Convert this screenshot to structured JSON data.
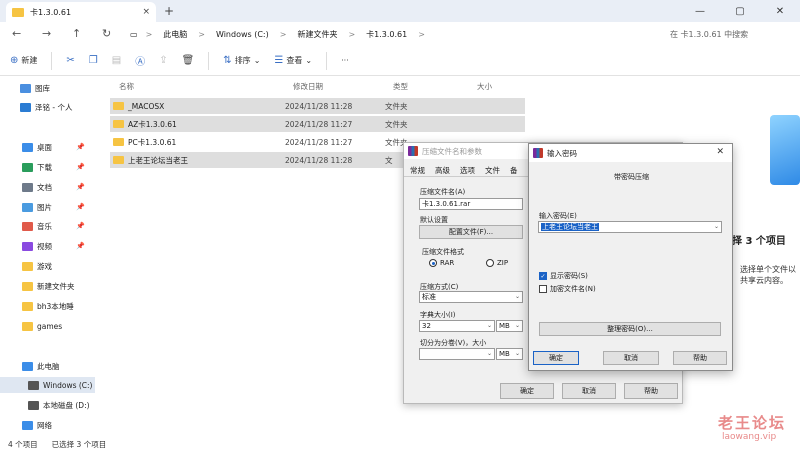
{
  "tab": {
    "title": "卡1.3.0.61",
    "close": "×",
    "new": "+"
  },
  "window": {
    "min": "—",
    "max": "▢",
    "close": "✕"
  },
  "nav": {
    "back": "←",
    "forward": "→",
    "up": "↑",
    "refresh": "↻",
    "monitor": "▭",
    "more": "›"
  },
  "address": {
    "segments": [
      "此电脑",
      "Windows (C:)",
      "新建文件夹",
      "卡1.3.0.61"
    ],
    "sep": ">"
  },
  "search": {
    "placeholder": "在 卡1.3.0.61 中搜索"
  },
  "toolbar": {
    "new": "新建",
    "sort": "排序",
    "view": "查看",
    "more": "···"
  },
  "sidebar": {
    "items": [
      {
        "label": "图库",
        "color": "#4a8fe0"
      },
      {
        "label": "泽铭 - 个人",
        "color": "#2b7cd3"
      },
      {
        "label": "桌面",
        "color": "#3b8de8",
        "pin": "📌"
      },
      {
        "label": "下载",
        "color": "#2a9d5c",
        "pin": "📌"
      },
      {
        "label": "文档",
        "color": "#6e7a8a",
        "pin": "📌"
      },
      {
        "label": "图片",
        "color": "#4a9be0",
        "pin": "📌"
      },
      {
        "label": "音乐",
        "color": "#e05a4a",
        "pin": "📌"
      },
      {
        "label": "视频",
        "color": "#8a4ae0",
        "pin": "📌"
      },
      {
        "label": "游戏",
        "color": "#f6c443"
      },
      {
        "label": "新建文件夹",
        "color": "#f6c443"
      },
      {
        "label": "bh3本地睡",
        "color": "#f6c443"
      },
      {
        "label": "games",
        "color": "#f6c443"
      },
      {
        "label": "此电脑",
        "color": "#3b8de8"
      },
      {
        "label": "Windows (C:)",
        "color": "#555"
      },
      {
        "label": "本地磁盘 (D:)",
        "color": "#555"
      },
      {
        "label": "网络",
        "color": "#3b8de8"
      }
    ]
  },
  "columns": {
    "name": "名称",
    "date": "修改日期",
    "type": "类型",
    "size": "大小"
  },
  "files": [
    {
      "name": "_MACOSX",
      "date": "2024/11/28 11:28",
      "type": "文件夹"
    },
    {
      "name": "AZ卡1.3.0.61",
      "date": "2024/11/28 11:27",
      "type": "文件夹"
    },
    {
      "name": "PC卡1.3.0.61",
      "date": "2024/11/28 11:27",
      "type": "文件夹"
    },
    {
      "name": "上老王论坛当老王",
      "date": "2024/11/28 11:28",
      "type": "文"
    }
  ],
  "details": {
    "title": "择 3 个项目",
    "text": "选择单个文件以共享云内容。"
  },
  "status": {
    "count": "4 个项目",
    "selected": "已选择 3 个项目"
  },
  "archive_dialog": {
    "title": "压缩文件名和参数",
    "tabs": [
      "常规",
      "高级",
      "选项",
      "文件",
      "备"
    ],
    "archive_name_label": "压缩文件名(A)",
    "archive_name": "卡1.3.0.61.rar",
    "default_settings": "默认设置",
    "profiles_btn": "配置文件(F)...",
    "format_label": "压缩文件格式",
    "format_rar": "RAR",
    "format_zip": "ZIP",
    "method_label": "压缩方式(C)",
    "method": "标准",
    "dict_label": "字典大小(I)",
    "dict": "32",
    "dict_unit": "MB",
    "split_label": "切分为分卷(V)，大小",
    "split": "",
    "split_unit": "MB",
    "ok": "确定",
    "cancel": "取消",
    "help": "帮助"
  },
  "password_dialog": {
    "title": "输入密码",
    "subtitle": "带密码压缩",
    "password_label": "输入密码(E)",
    "password": "上老王论坛当老王",
    "show_password": "显示密码(S)",
    "encrypt_names": "加密文件名(N)",
    "organize_btn": "整理密码(O)...",
    "ok": "确定",
    "cancel": "取消",
    "help": "帮助"
  },
  "watermark": {
    "text": "老王论坛",
    "url": "laowang.vip"
  }
}
